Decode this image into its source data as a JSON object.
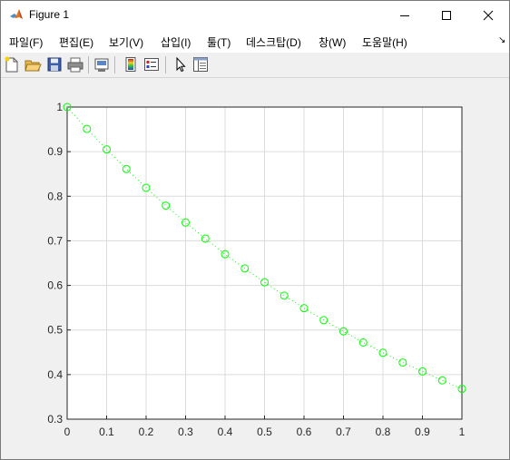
{
  "window": {
    "title": "Figure 1",
    "icon": "matlab-logo-icon",
    "controls": [
      "minimize-icon",
      "maximize-icon",
      "close-icon"
    ]
  },
  "menu": {
    "items": [
      "파일(F)",
      "편집(E)",
      "보기(V)",
      "삽입(I)",
      "툴(T)",
      "데스크탑(D)",
      "창(W)",
      "도움말(H)"
    ],
    "overflow_icon": "dock-arrow-icon"
  },
  "toolbar": {
    "buttons": [
      "new-figure-icon",
      "open-file-icon",
      "save-icon",
      "print-icon",
      "link-plot-icon",
      "colorbar-icon",
      "legend-icon",
      "pointer-icon",
      "property-inspector-icon"
    ]
  },
  "chart_data": {
    "type": "line",
    "title": "",
    "xlabel": "",
    "ylabel": "",
    "xlim": [
      0,
      1
    ],
    "ylim": [
      0.3,
      1
    ],
    "xticks": [
      "0",
      "0.1",
      "0.2",
      "0.3",
      "0.4",
      "0.5",
      "0.6",
      "0.7",
      "0.8",
      "0.9",
      "1"
    ],
    "yticks": [
      "0.3",
      "0.4",
      "0.5",
      "0.6",
      "0.7",
      "0.8",
      "0.9",
      "1"
    ],
    "grid": true,
    "series": [
      {
        "color": "#00ff00",
        "line_style": "dotted",
        "marker": "circle",
        "x": [
          0,
          0.05,
          0.1,
          0.15,
          0.2,
          0.25,
          0.3,
          0.35,
          0.4,
          0.45,
          0.5,
          0.55,
          0.6,
          0.65,
          0.7,
          0.75,
          0.8,
          0.85,
          0.9,
          0.95,
          1
        ],
        "y": [
          1.0,
          0.951,
          0.905,
          0.861,
          0.819,
          0.779,
          0.741,
          0.705,
          0.67,
          0.638,
          0.607,
          0.577,
          0.549,
          0.522,
          0.497,
          0.472,
          0.449,
          0.427,
          0.407,
          0.387,
          0.368
        ]
      }
    ]
  }
}
